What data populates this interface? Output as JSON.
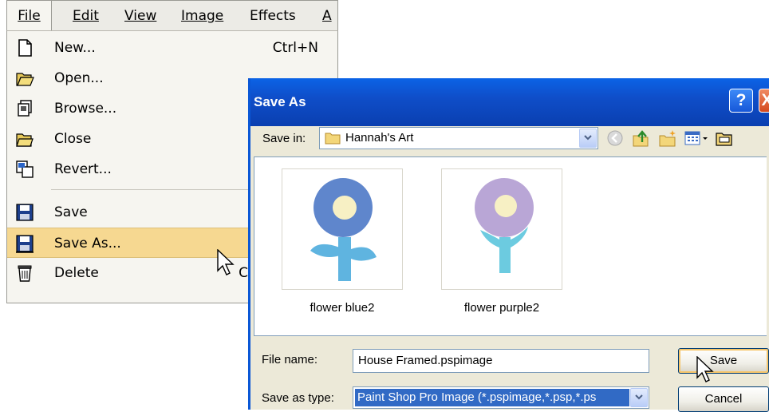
{
  "menubar": {
    "items": [
      {
        "label": "File"
      },
      {
        "label": "Edit"
      },
      {
        "label": "View"
      },
      {
        "label": "Image"
      },
      {
        "label": "Effects"
      },
      {
        "label": "A"
      }
    ]
  },
  "file_menu": {
    "items": [
      {
        "label": "New...",
        "shortcut": "Ctrl+N",
        "icon": "new-document-icon"
      },
      {
        "label": "Open...",
        "shortcut": "",
        "icon": "open-folder-icon"
      },
      {
        "label": "Browse...",
        "shortcut": "",
        "icon": "browse-icon"
      },
      {
        "label": "Close",
        "shortcut": "",
        "icon": "close-folder-icon"
      },
      {
        "label": "Revert...",
        "shortcut": "",
        "icon": "revert-icon"
      },
      {
        "label": "Save",
        "shortcut": "",
        "icon": "save-disk-icon"
      },
      {
        "label": "Save As...",
        "shortcut": "",
        "icon": "save-as-disk-icon",
        "highlighted": true
      },
      {
        "label": "Delete",
        "shortcut": "C",
        "icon": "trash-icon"
      }
    ]
  },
  "dialog": {
    "title": "Save As",
    "help_label": "?",
    "close_label": "X",
    "save_in_label": "Save in:",
    "save_in_value": "Hannah's Art",
    "files": [
      {
        "name": "flower blue2",
        "petal_color": "#5f86cc"
      },
      {
        "name": "flower purple2",
        "petal_color": "#b9a6d6"
      }
    ],
    "file_name_label": "File name:",
    "file_name_value": "House Framed.pspimage",
    "save_as_type_label": "Save as type:",
    "save_as_type_value": "Paint Shop Pro Image (*.pspimage,*.psp,*.ps",
    "save_button": "Save",
    "cancel_button": "Cancel"
  },
  "colors": {
    "titlebar": "#0f4ec9",
    "menu_highlight": "#f6d891",
    "selection": "#316ac5"
  }
}
